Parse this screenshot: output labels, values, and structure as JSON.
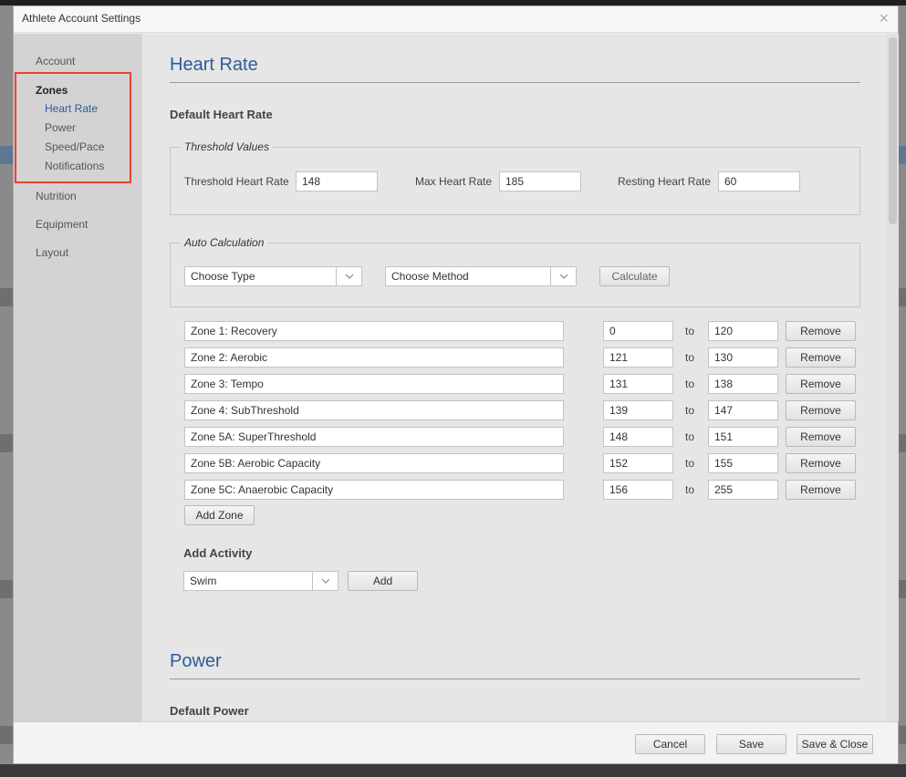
{
  "window": {
    "title": "Athlete Account Settings",
    "close_glyph": "×"
  },
  "sidebar": {
    "account": "Account",
    "zones": "Zones",
    "zone_items": [
      "Heart Rate",
      "Power",
      "Speed/Pace",
      "Notifications"
    ],
    "nutrition": "Nutrition",
    "equipment": "Equipment",
    "layout": "Layout",
    "highlight_color": "#e8432e",
    "active_color": "#2b5c99"
  },
  "heart_rate": {
    "title": "Heart Rate",
    "default_heading": "Default Heart Rate",
    "threshold_legend": "Threshold Values",
    "threshold_label": "Threshold Heart Rate",
    "threshold_value": "148",
    "max_label": "Max Heart Rate",
    "max_value": "185",
    "resting_label": "Resting Heart Rate",
    "resting_value": "60",
    "auto_legend": "Auto Calculation",
    "type_select": "Choose Type",
    "method_select": "Choose Method",
    "calculate_label": "Calculate",
    "to_label": "to",
    "remove_label": "Remove",
    "zones": [
      {
        "name": "Zone 1: Recovery",
        "from": "0",
        "to": "120"
      },
      {
        "name": "Zone 2: Aerobic",
        "from": "121",
        "to": "130"
      },
      {
        "name": "Zone 3: Tempo",
        "from": "131",
        "to": "138"
      },
      {
        "name": "Zone 4: SubThreshold",
        "from": "139",
        "to": "147"
      },
      {
        "name": "Zone 5A: SuperThreshold",
        "from": "148",
        "to": "151"
      },
      {
        "name": "Zone 5B: Aerobic Capacity",
        "from": "152",
        "to": "155"
      },
      {
        "name": "Zone 5C: Anaerobic Capacity",
        "from": "156",
        "to": "255"
      }
    ],
    "add_zone_label": "Add Zone",
    "add_activity_heading": "Add Activity",
    "activity_select": "Swim",
    "add_label": "Add"
  },
  "power": {
    "title": "Power",
    "default_heading": "Default Power"
  },
  "footer": {
    "cancel": "Cancel",
    "save": "Save",
    "save_close": "Save & Close"
  },
  "icons": {
    "select_arrow": "chevron-down-icon",
    "close": "close-icon"
  }
}
